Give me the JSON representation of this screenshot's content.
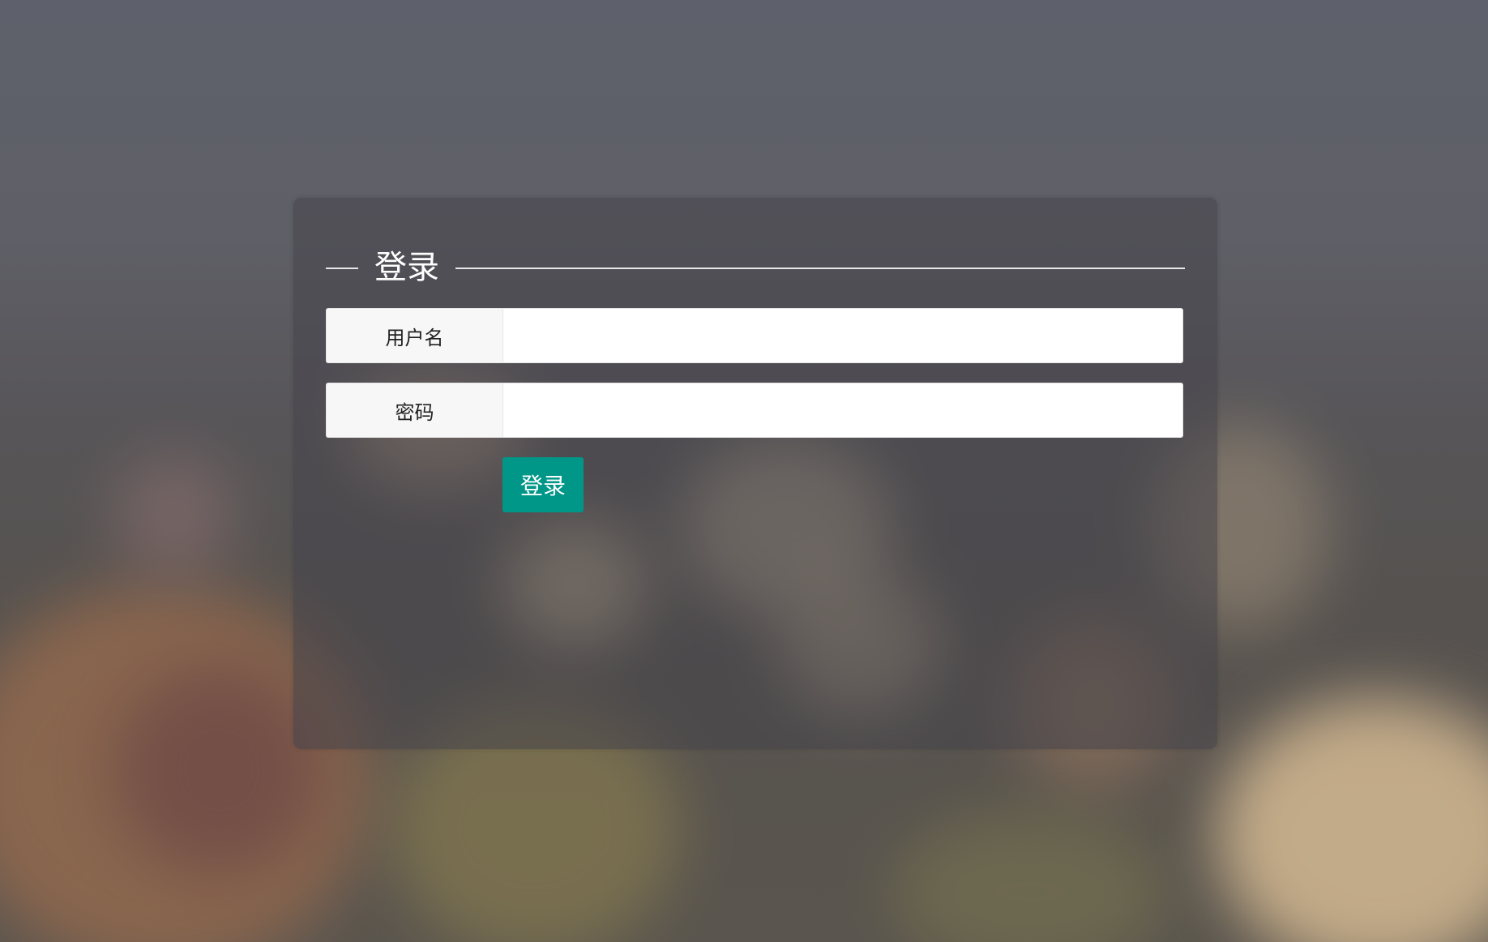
{
  "form": {
    "title": "登录",
    "username_label": "用户名",
    "username_value": "",
    "password_label": "密码",
    "password_value": "",
    "submit_label": "登录"
  },
  "colors": {
    "submit_button": "#009688",
    "panel_overlay": "rgba(70, 68, 74, 0.55)",
    "label_background": "#f7f7f7",
    "input_background": "#ffffff"
  }
}
